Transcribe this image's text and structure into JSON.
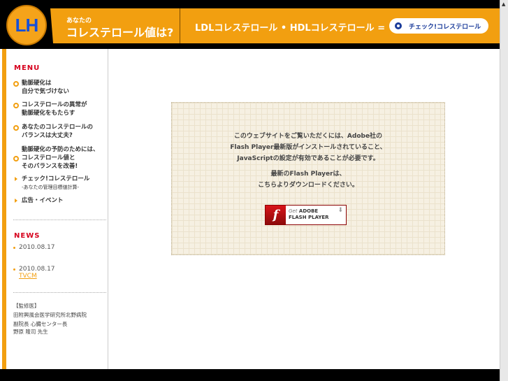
{
  "header": {
    "logo": "LH",
    "subtitle": "あなたの",
    "title": "コレステロール値は?",
    "formula": "LDLコレステロール • HDLコレステロール =",
    "check_button": "チェック!コレステロール"
  },
  "sidebar": {
    "menu_heading": "MENU",
    "menu": [
      {
        "lines": [
          "動脈硬化は",
          "自分で気づけない"
        ]
      },
      {
        "lines": [
          "コレステロールの異常が",
          "動脈硬化をもたらす"
        ]
      },
      {
        "lines": [
          "あなたのコレステロールの",
          "バランスは大丈夫?"
        ]
      },
      {
        "lines": [
          "動脈硬化の予防のためには、",
          "コレステロール値と",
          "そのバランスを改善!"
        ]
      },
      {
        "label": "チェック!コレステロール",
        "sub": "-あなたの管理目標値計算-"
      },
      {
        "label": "広告・イベント"
      }
    ],
    "news_heading": "NEWS",
    "news": [
      {
        "date": "2010.08.17"
      },
      {
        "date": "2010.08.17",
        "link": "TVCM"
      }
    ],
    "supervisor": [
      "【監修医】",
      "田附興風会医学研究所北野病院",
      "副院長 心臓センター長",
      "野原 隆司 先生"
    ]
  },
  "main": {
    "notice": [
      "このウェブサイトをご覧いただくには、Adobe社の",
      "Flash Player最新版がインストールされていること、",
      "JavaScriptの設定が有効であることが必要です。"
    ],
    "download": [
      "最新のFlash Playerは、",
      "こちらよりダウンロードください。"
    ],
    "badge": {
      "line1a": "Get",
      "line1b": "ADOBE",
      "line2": "FLASH PLAYER"
    }
  }
}
